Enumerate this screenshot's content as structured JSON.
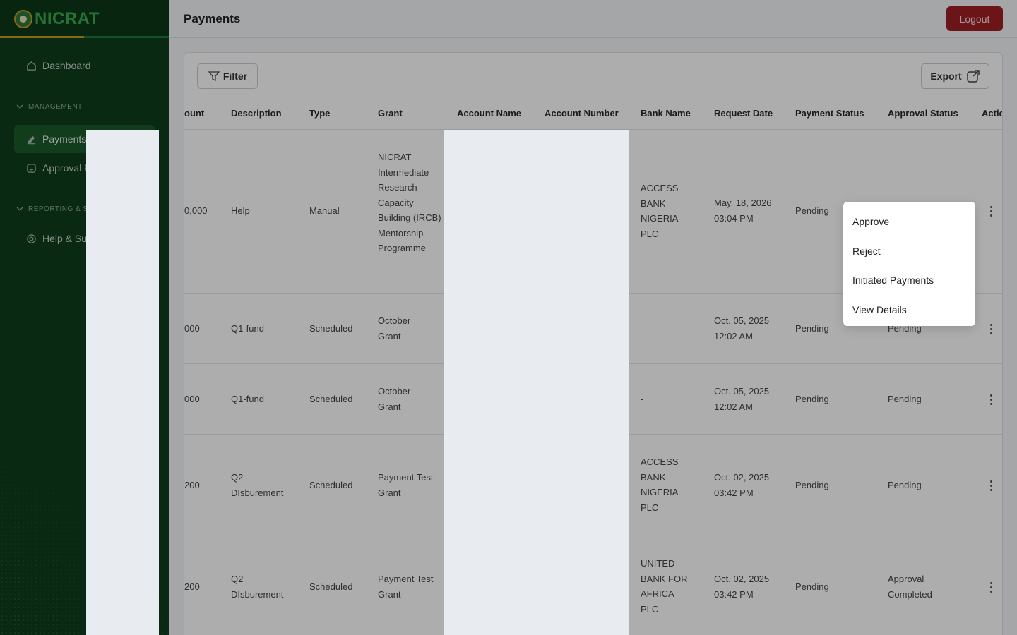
{
  "sidebar": {
    "brand": "NICRAT",
    "items": [
      {
        "label": "Dashboard",
        "icon": "home-icon"
      }
    ],
    "sections": [
      {
        "label": "MANAGEMENT",
        "items": [
          {
            "label": "Payments",
            "icon": "payments-icon",
            "active": true
          },
          {
            "label": "Approval F",
            "icon": "approval-icon"
          }
        ]
      },
      {
        "label": "REPORTING & SUP",
        "items": [
          {
            "label": "Help & Su",
            "icon": "help-icon"
          }
        ]
      }
    ]
  },
  "header": {
    "title": "Payments",
    "logout_label": "Logout"
  },
  "toolbar": {
    "filter_label": "Filter",
    "export_label": "Export"
  },
  "table": {
    "columns": [
      "ount",
      "Description",
      "Type",
      "Grant",
      "Account Name",
      "Account Number",
      "Bank Name",
      "Request Date",
      "Payment Status",
      "Approval Status",
      "Actic"
    ],
    "rows": [
      {
        "amount": "0,000",
        "description": "Help",
        "type": "Manual",
        "grant": "NICRAT Intermediate Research Capacity Building (IRCB) Mentorship Programme",
        "bank": "ACCESS BANK NIGERIA PLC",
        "date": "May. 18, 2026",
        "time": "03:04 PM",
        "payment_status": "Pending",
        "approval_status": ""
      },
      {
        "amount": "000",
        "description": "Q1-fund",
        "type": "Scheduled",
        "grant": "October Grant",
        "bank": "-",
        "date": "Oct. 05, 2025",
        "time": "12:02 AM",
        "payment_status": "Pending",
        "approval_status": "Pending"
      },
      {
        "amount": "000",
        "description": "Q1-fund",
        "type": "Scheduled",
        "grant": "October Grant",
        "bank": "-",
        "date": "Oct. 05, 2025",
        "time": "12:02 AM",
        "payment_status": "Pending",
        "approval_status": "Pending"
      },
      {
        "amount": "200",
        "description": "Q2 DIsburement",
        "type": "Scheduled",
        "grant": "Payment Test Grant",
        "bank": "ACCESS BANK NIGERIA PLC",
        "date": "Oct. 02, 2025",
        "time": "03:42 PM",
        "payment_status": "Pending",
        "approval_status": "Pending"
      },
      {
        "amount": "200",
        "description": "Q2 DIsburement",
        "type": "Scheduled",
        "grant": "Payment Test Grant",
        "bank": "UNITED BANK FOR AFRICA PLC",
        "date": "Oct. 02, 2025",
        "time": "03:42 PM",
        "payment_status": "Pending",
        "approval_status": "Approval Completed"
      }
    ]
  },
  "action_menu": {
    "items": [
      "Approve",
      "Reject",
      "Initiated Payments",
      "View Details"
    ]
  },
  "colors": {
    "sidebar_bg": "#0f3d1c",
    "logout_bg": "#9e1f25",
    "active_nav": "#1a5a2b",
    "brand_gold": "#c99a1e",
    "brand_green": "#3aa84f"
  }
}
